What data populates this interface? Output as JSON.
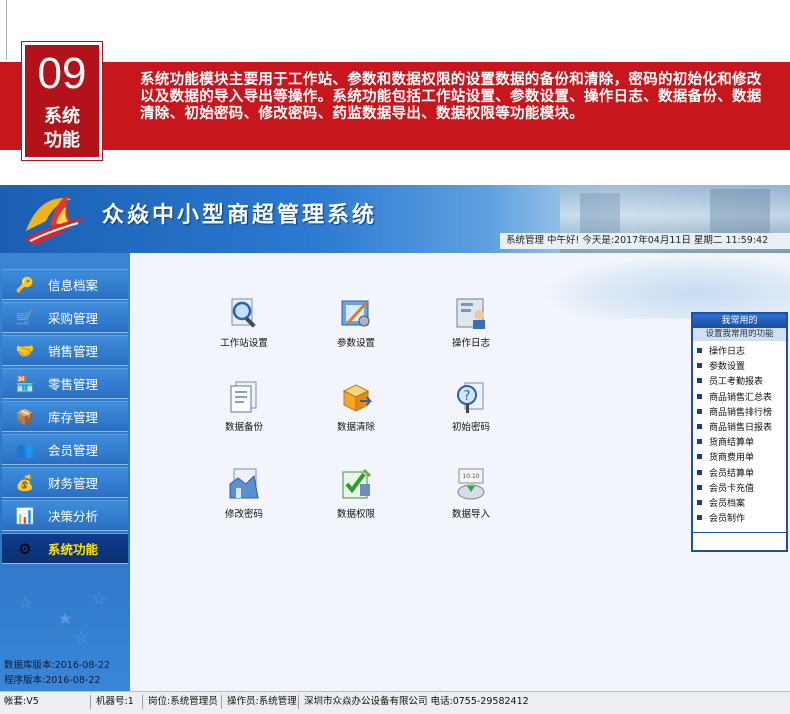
{
  "banner": {
    "number": "09",
    "label_line1": "系统",
    "label_line2": "功能",
    "description": "系统功能模块主要用于工作站、参数和数据权限的设置数据的备份和清除，密码的初始化和修改以及数据的导入导出等操作。系统功能包括工作站设置、参数设置、操作日志、数据备份、数据清除、初始密码、修改密码、药监数据导出、数据权限等功能模块。"
  },
  "app": {
    "title": "众焱中小型商超管理系统",
    "info": "系统管理  中午好!  今天是:2017年04月11日  星期二  11:59:42"
  },
  "sidebar": {
    "items": [
      {
        "label": "信息档案",
        "icon": "key-search-icon"
      },
      {
        "label": "采购管理",
        "icon": "cart-icon"
      },
      {
        "label": "销售管理",
        "icon": "handshake-icon"
      },
      {
        "label": "零售管理",
        "icon": "register-icon"
      },
      {
        "label": "库存管理",
        "icon": "warehouse-icon"
      },
      {
        "label": "会员管理",
        "icon": "members-icon"
      },
      {
        "label": "财务管理",
        "icon": "moneybag-icon"
      },
      {
        "label": "决策分析",
        "icon": "chart-icon"
      },
      {
        "label": "系统功能",
        "icon": "gear-icon"
      }
    ],
    "db_version": "数据库版本:2016-08-22",
    "app_version": "程序版本:2016-08-22"
  },
  "functions": [
    {
      "label": "工作站设置",
      "icon": "magnifier-icon"
    },
    {
      "label": "参数设置",
      "icon": "settings-tools-icon"
    },
    {
      "label": "操作日志",
      "icon": "user-log-icon"
    },
    {
      "label": "数据备份",
      "icon": "document-backup-icon"
    },
    {
      "label": "数据清除",
      "icon": "box-clear-icon"
    },
    {
      "label": "初始密码",
      "icon": "question-key-icon"
    },
    {
      "label": "修改密码",
      "icon": "chart-key-icon"
    },
    {
      "label": "数据权限",
      "icon": "checklist-icon"
    },
    {
      "label": "数据导入",
      "icon": "import-icon"
    }
  ],
  "quick": {
    "header": "我常用的",
    "subheader": "设置我常用的功能",
    "items": [
      "操作日志",
      "参数设置",
      "员工考勤报表",
      "商品销售汇总表",
      "商品销售排行榜",
      "商品销售日报表",
      "货商结算单",
      "货商费用单",
      "会员结算单",
      "会员卡充值",
      "会员档案",
      "会员制作"
    ]
  },
  "status": {
    "account": "帐套:V5",
    "machine": "机器号:1",
    "position": "岗位:系统管理员",
    "operator": "操作员:系统管理",
    "company": "深圳市众焱办公设备有限公司 电话:0755-29582412"
  },
  "colors": {
    "banner_red": "#c8171c",
    "sidebar_blue": "#2e74c6",
    "active_nav": "#0b2f73",
    "active_label": "#ffe000"
  }
}
